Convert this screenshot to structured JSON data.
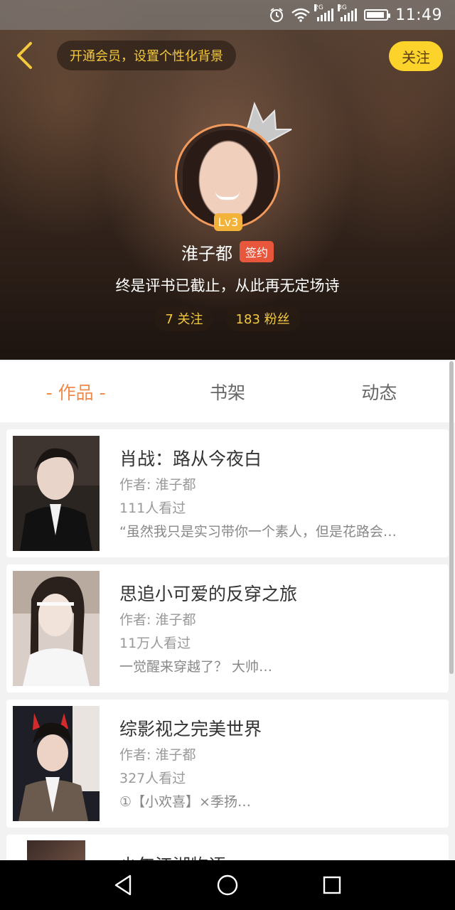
{
  "statusbar": {
    "network_1": "2G",
    "network_2": "3G",
    "time": "11:49",
    "icons": [
      "alarm-icon",
      "wifi-icon",
      "signal-icon",
      "battery-icon"
    ]
  },
  "header": {
    "vip_prompt": "开通会员，设置个性化背景",
    "follow_label": "关注",
    "level": "Lv3",
    "username": "淮子都",
    "sign_badge": "签约",
    "bio": "终是评书已截止，从此再无定场诗",
    "following": "7 关注",
    "followers": "183 粉丝"
  },
  "tabs": {
    "works": "- 作品 -",
    "bookshelf": "书架",
    "activity": "动态"
  },
  "works": [
    {
      "title": "肖战：路从今夜白",
      "author": "作者: 淮子都",
      "views": "111人看过",
      "desc": "“虽然我只是实习带你一个素人，但是花路会…"
    },
    {
      "title": "思追小可爱的反穿之旅",
      "author": "作者: 淮子都",
      "views": "11万人看过",
      "desc": "一觉醒来穿越了？ 大帅…"
    },
    {
      "title": "综影视之完美世界",
      "author": "作者: 淮子都",
      "views": "327人看过",
      "desc": "①【小欢喜】×季扬…"
    }
  ],
  "partial_work": {
    "title": "少年江湖物语"
  },
  "colors": {
    "accent": "#f08a4b",
    "vip_text": "#f4c93c",
    "follow_bg": "#fbd32a",
    "sign_badge_bg": "#e8563c",
    "level_bg": "#f3b23a"
  }
}
